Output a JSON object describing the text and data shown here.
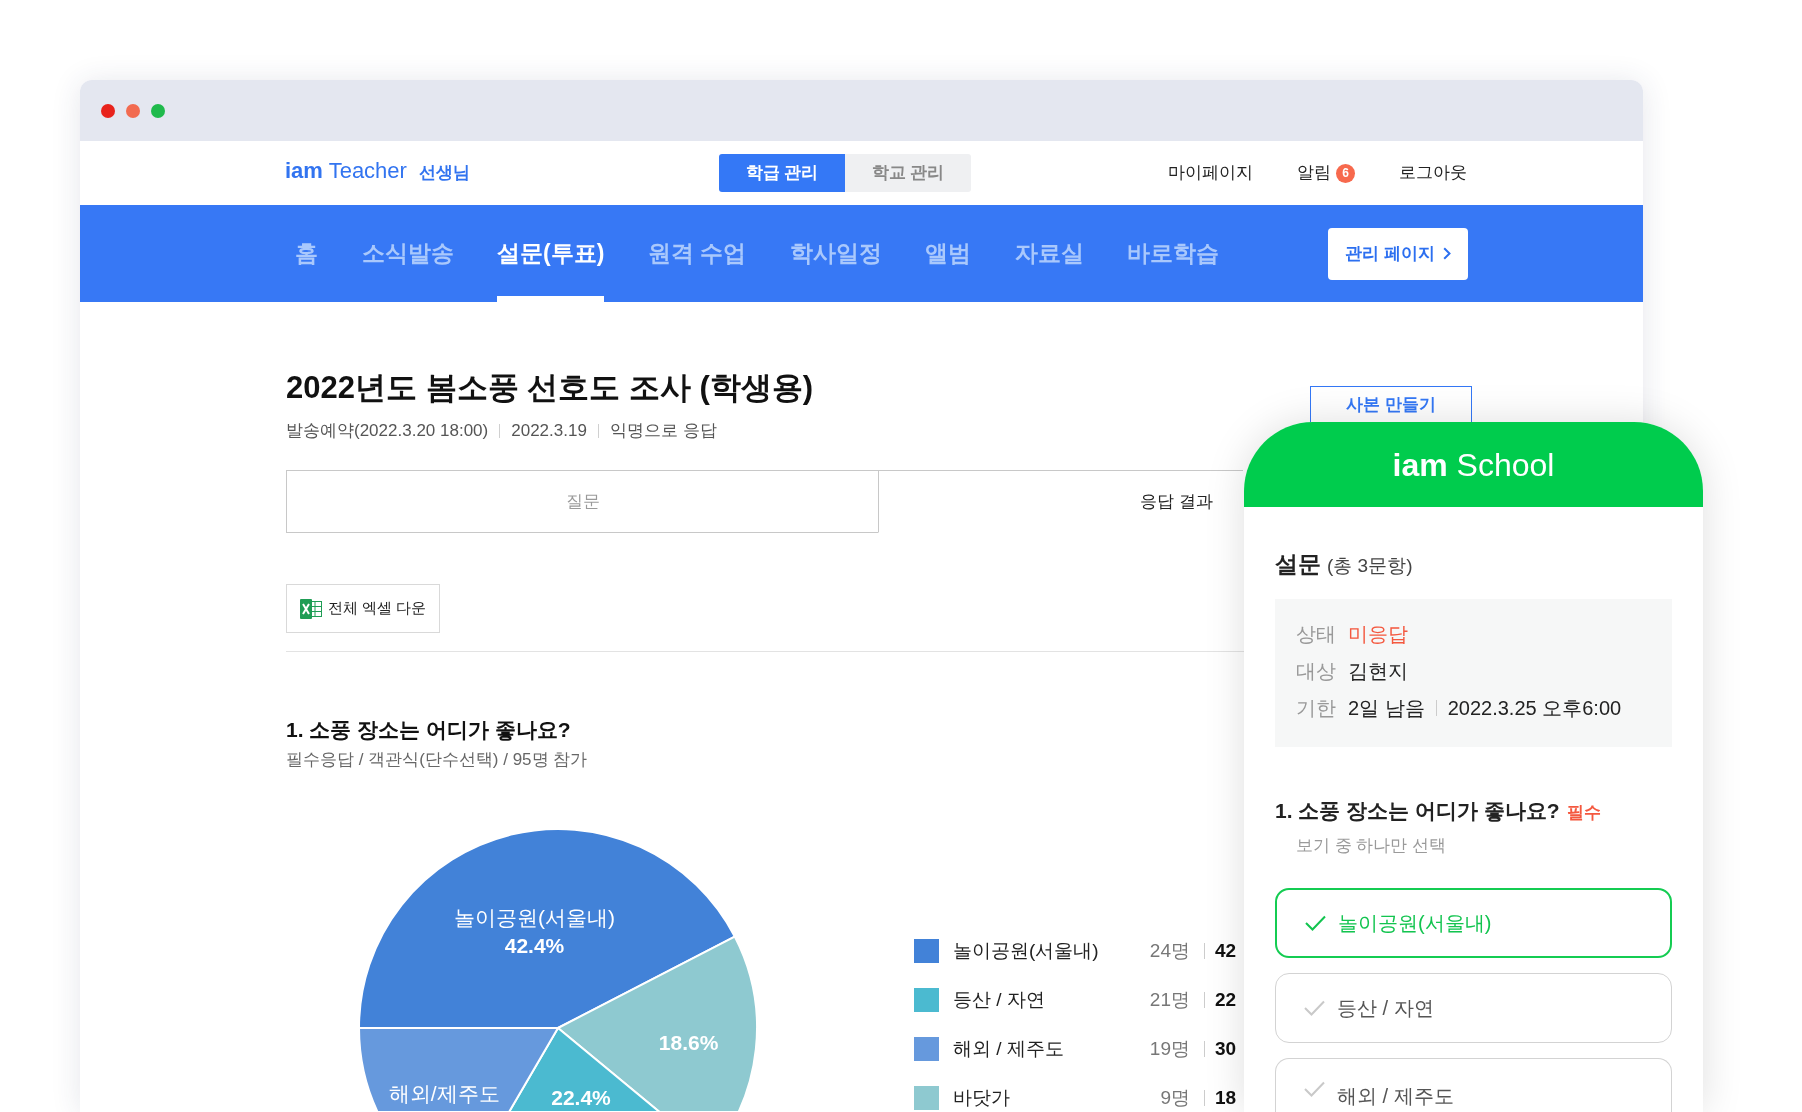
{
  "title_bar": {
    "buttons": [
      {
        "color": "#e8231c"
      },
      {
        "color": "#f26b50"
      },
      {
        "color": "#1fba4c"
      }
    ]
  },
  "header": {
    "logo": {
      "mark": "iam",
      "name": "Teacher",
      "role": "선생님"
    },
    "switch": [
      {
        "label": "학급 관리",
        "selected": true
      },
      {
        "label": "학교 관리",
        "selected": false
      }
    ],
    "links": [
      {
        "label": "마이페이지"
      },
      {
        "label": "알림",
        "badge": "6"
      },
      {
        "label": "로그아웃"
      }
    ]
  },
  "nav": {
    "items": [
      {
        "label": "홈",
        "selected": false
      },
      {
        "label": "소식발송",
        "selected": false
      },
      {
        "label": "설문(투표)",
        "selected": true
      },
      {
        "label": "원격 수업",
        "selected": false
      },
      {
        "label": "학사일정",
        "selected": false
      },
      {
        "label": "앨범",
        "selected": false
      },
      {
        "label": "자료실",
        "selected": false
      },
      {
        "label": "바로학습",
        "selected": false
      }
    ],
    "admin_button": "관리 페이지"
  },
  "survey": {
    "title": "2022년도 봄소풍 선호도 조사 (학생용)",
    "meta": [
      "발송예약(2022.3.20 18:00)",
      "2022.3.19",
      "익명으로 응답"
    ],
    "copy_button": "사본 만들기",
    "tabs": [
      {
        "label": "질문",
        "selected": false
      },
      {
        "label": "응답 결과",
        "selected": true
      }
    ],
    "excel_button": "전체 엑셀 다운",
    "question": {
      "title": "1. 소풍 장소는 어디가 좋나요?",
      "details": "필수응답 / 객관식(단수선택) / 95명 참가",
      "chart_data": {
        "type": "pie",
        "values": [
          42.4,
          18.6,
          22.4,
          16.6
        ],
        "colors": [
          "#4282d8",
          "#8ec9d0",
          "#4bbad0",
          "#6699dd"
        ]
      },
      "pie_labels": [
        {
          "kind": "name_value",
          "name": "놀이공원(서울내)",
          "value": "42.4%"
        },
        {
          "kind": "value",
          "value": "18.6%"
        },
        {
          "kind": "value",
          "value": "22.4%"
        },
        {
          "kind": "name",
          "name": "해외/제주도"
        }
      ],
      "legend": [
        {
          "label": "놀이공원(서울내)",
          "color": "#4282d8",
          "count": "24명",
          "percent": "42"
        },
        {
          "label": "등산 / 자연",
          "color": "#4bbad0",
          "count": "21명",
          "percent": "22"
        },
        {
          "label": "해외 / 제주도",
          "color": "#6699dd",
          "count": "19명",
          "percent": "30"
        },
        {
          "label": "바닷가",
          "color": "#8ec9d0",
          "count": "9명",
          "percent": "18"
        }
      ]
    }
  },
  "phone": {
    "logo": {
      "mark": "iam",
      "name": "School"
    },
    "heading": "설문",
    "count": "(총 3문항)",
    "info": [
      {
        "kind": "status",
        "label": "상태",
        "values": [
          "미응답"
        ]
      },
      {
        "kind": "text",
        "label": "대상",
        "values": [
          "김현지"
        ]
      },
      {
        "kind": "text",
        "label": "기한",
        "values": [
          "2일 남음",
          "2022.3.25 오후6:00"
        ]
      }
    ],
    "question": {
      "title": "1. 소풍 장소는 어디가 좋나요?",
      "required": "필수",
      "hint": "보기 중 하나만 선택",
      "options": [
        {
          "label": "놀이공원(서울내)",
          "selected": true
        },
        {
          "label": "등산 / 자연",
          "selected": false
        },
        {
          "label": "해외 / 제주도",
          "selected": false
        }
      ]
    }
  }
}
